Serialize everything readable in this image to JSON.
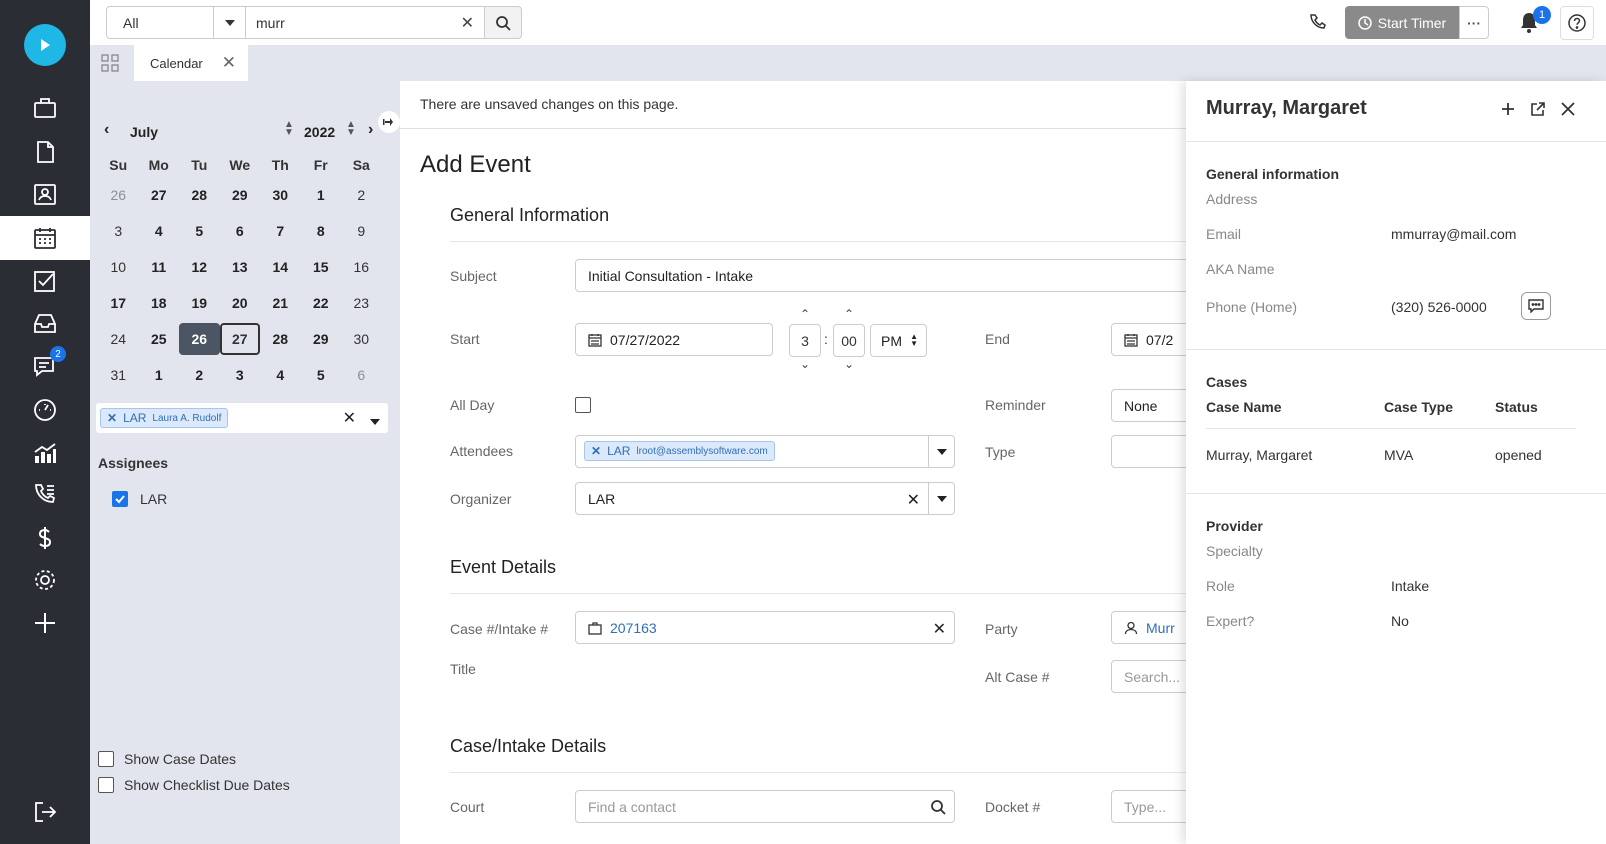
{
  "rail": {
    "logo_icon": "play-logo-icon",
    "items": [
      {
        "icon": "briefcase-icon"
      },
      {
        "icon": "document-icon"
      },
      {
        "icon": "contact-card-icon"
      },
      {
        "icon": "calendar-icon",
        "active": true
      },
      {
        "icon": "checkbox-task-icon"
      },
      {
        "icon": "inbox-icon"
      },
      {
        "icon": "chat-icon",
        "badge": "2"
      },
      {
        "icon": "dashboard-gauge-icon"
      },
      {
        "icon": "chart-icon"
      },
      {
        "icon": "phone-list-icon"
      },
      {
        "icon": "dollar-icon"
      },
      {
        "icon": "settings-gear-icon"
      },
      {
        "icon": "plus-icon"
      }
    ],
    "logout_icon": "logout-icon"
  },
  "topbar": {
    "scope_value": "All",
    "search_value": "murr",
    "timer_label": "Start Timer",
    "notification_count": "1"
  },
  "tabs": [
    {
      "label": "Calendar"
    }
  ],
  "calendar": {
    "month": "July",
    "year": "2022",
    "weekdays": [
      "Su",
      "Mo",
      "Tu",
      "We",
      "Th",
      "Fr",
      "Sa"
    ],
    "weeks": [
      [
        {
          "d": "26",
          "s": "muted"
        },
        {
          "d": "27",
          "s": "muted bold"
        },
        {
          "d": "28",
          "s": "muted bold"
        },
        {
          "d": "29",
          "s": "muted bold"
        },
        {
          "d": "30",
          "s": "muted bold"
        },
        {
          "d": "1",
          "s": "bold"
        },
        {
          "d": "2",
          "s": ""
        }
      ],
      [
        {
          "d": "3",
          "s": ""
        },
        {
          "d": "4",
          "s": "bold"
        },
        {
          "d": "5",
          "s": "bold"
        },
        {
          "d": "6",
          "s": "bold"
        },
        {
          "d": "7",
          "s": "bold"
        },
        {
          "d": "8",
          "s": "bold"
        },
        {
          "d": "9",
          "s": ""
        }
      ],
      [
        {
          "d": "10",
          "s": ""
        },
        {
          "d": "11",
          "s": "bold"
        },
        {
          "d": "12",
          "s": "bold"
        },
        {
          "d": "13",
          "s": "bold"
        },
        {
          "d": "14",
          "s": "bold"
        },
        {
          "d": "15",
          "s": "bold"
        },
        {
          "d": "16",
          "s": ""
        }
      ],
      [
        {
          "d": "17",
          "s": "bold"
        },
        {
          "d": "18",
          "s": "bold"
        },
        {
          "d": "19",
          "s": "bold"
        },
        {
          "d": "20",
          "s": "bold"
        },
        {
          "d": "21",
          "s": "bold"
        },
        {
          "d": "22",
          "s": "bold"
        },
        {
          "d": "23",
          "s": ""
        }
      ],
      [
        {
          "d": "24",
          "s": ""
        },
        {
          "d": "25",
          "s": "bold"
        },
        {
          "d": "26",
          "s": "selected"
        },
        {
          "d": "27",
          "s": "today"
        },
        {
          "d": "28",
          "s": "bold"
        },
        {
          "d": "29",
          "s": "bold"
        },
        {
          "d": "30",
          "s": ""
        }
      ],
      [
        {
          "d": "31",
          "s": ""
        },
        {
          "d": "1",
          "s": "muted bold"
        },
        {
          "d": "2",
          "s": "muted bold"
        },
        {
          "d": "3",
          "s": "muted bold"
        },
        {
          "d": "4",
          "s": "muted bold"
        },
        {
          "d": "5",
          "s": "muted bold"
        },
        {
          "d": "6",
          "s": "muted"
        }
      ]
    ],
    "filter_chip": {
      "code": "LAR",
      "name": "Laura A. Rudolf"
    },
    "assignees_title": "Assignees",
    "assignee": "LAR",
    "show_case_dates": "Show Case Dates",
    "show_checklist_due_dates": "Show Checklist Due Dates"
  },
  "form": {
    "unsaved_notice": "There are unsaved changes on this page.",
    "title": "Add Event",
    "general_section": "General Information",
    "subject_label": "Subject",
    "subject_value": "Initial Consultation - Intake",
    "start_label": "Start",
    "start_date": "07/27/2022",
    "start_hour": "3",
    "start_minute": "00",
    "start_ampm": "PM",
    "end_label": "End",
    "end_date": "07/2",
    "all_day_label": "All Day",
    "reminder_label": "Reminder",
    "reminder_value": "None",
    "attendees_label": "Attendees",
    "attendee_chip": {
      "code": "LAR",
      "email": "lroot@assemblysoftware.com"
    },
    "type_label": "Type",
    "organizer_label": "Organizer",
    "organizer_value": "LAR",
    "event_details_section": "Event Details",
    "case_label": "Case #/Intake #",
    "case_value": "207163",
    "party_label": "Party",
    "party_value": "Murr",
    "title_label": "Title",
    "alt_case_label": "Alt Case #",
    "alt_case_placeholder": "Search...",
    "case_intake_section": "Case/Intake Details",
    "court_label": "Court",
    "court_placeholder": "Find a contact",
    "docket_label": "Docket #",
    "docket_placeholder": "Type..."
  },
  "contact": {
    "name": "Murray, Margaret",
    "general_info_title": "General information",
    "address_label": "Address",
    "email_label": "Email",
    "email_value": "mmurray@mail.com",
    "aka_label": "AKA Name",
    "phone_label": "Phone (Home)",
    "phone_value": "(320) 526-0000",
    "cases_title": "Cases",
    "cases_headers": [
      "Case Name",
      "Case Type",
      "Status"
    ],
    "cases_rows": [
      [
        "Murray, Margaret",
        "MVA",
        "opened"
      ]
    ],
    "provider_title": "Provider",
    "specialty_label": "Specialty",
    "role_label": "Role",
    "role_value": "Intake",
    "expert_label": "Expert?",
    "expert_value": "No"
  },
  "colors": {
    "rail_bg": "#2b2d34",
    "logo": "#1fb8e6",
    "accent": "#1a73e8",
    "link": "#2f6fb8"
  }
}
